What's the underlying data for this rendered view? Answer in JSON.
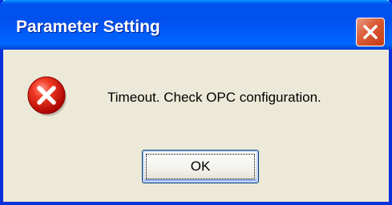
{
  "window": {
    "title": "Parameter Setting",
    "close_icon": "close-icon"
  },
  "dialog": {
    "icon": "error-icon",
    "message": "Timeout. Check OPC configuration.",
    "ok_label": "OK"
  },
  "colors": {
    "titlebar": "#0054e3",
    "frame": "#0831d9",
    "background": "#ece9d8",
    "close_button": "#d95b35",
    "error_red": "#d90000"
  }
}
